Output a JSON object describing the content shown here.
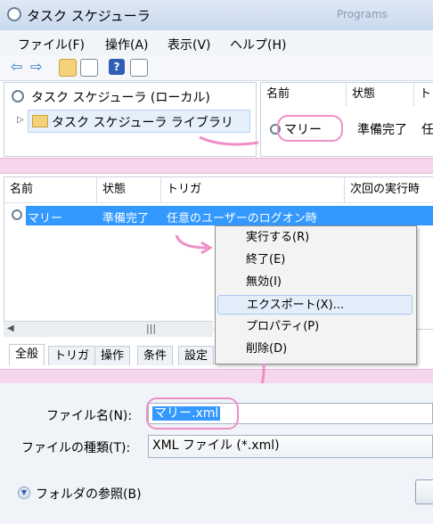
{
  "window": {
    "title": "タスク スケジューラ",
    "bg_tab": "Programs"
  },
  "menu": [
    "ファイル(F)",
    "操作(A)",
    "表示(V)",
    "ヘルプ(H)"
  ],
  "toolbar_icons": [
    "back-arrow-icon",
    "forward-arrow-icon",
    "up-folder-icon",
    "console-tree-icon",
    "help-icon",
    "action-pane-icon"
  ],
  "tree": {
    "root": "タスク スケジューラ (ローカル)",
    "library": "タスク スケジューラ ライブラリ"
  },
  "right_pane": {
    "columns": [
      "名前",
      "状態",
      "ト"
    ],
    "row": {
      "name": "マリー",
      "status": "準備完了",
      "extra": "任"
    }
  },
  "task_list": {
    "columns": [
      "名前",
      "状態",
      "トリガ",
      "次回の実行時"
    ],
    "row": {
      "name": "マリー",
      "status": "準備完了",
      "trigger": "任意のユーザーのログオン時"
    }
  },
  "context_menu": [
    "実行する(R)",
    "終了(E)",
    "無効(I)",
    "エクスポート(X)...",
    "プロパティ(P)",
    "削除(D)"
  ],
  "tabs": [
    "全般",
    "トリガ",
    "操作",
    "条件",
    "設定"
  ],
  "save_dialog": {
    "filename_label": "ファイル名(N):",
    "filename_value": "マリー.xml",
    "filetype_label": "ファイルの種類(T):",
    "filetype_value": "XML ファイル (*.xml)",
    "browse_label": "フォルダの参照(B)"
  },
  "accent_colors": {
    "highlight": "#3399ff",
    "annotation": "#ee8fc8",
    "band": "#f6d6ec"
  }
}
